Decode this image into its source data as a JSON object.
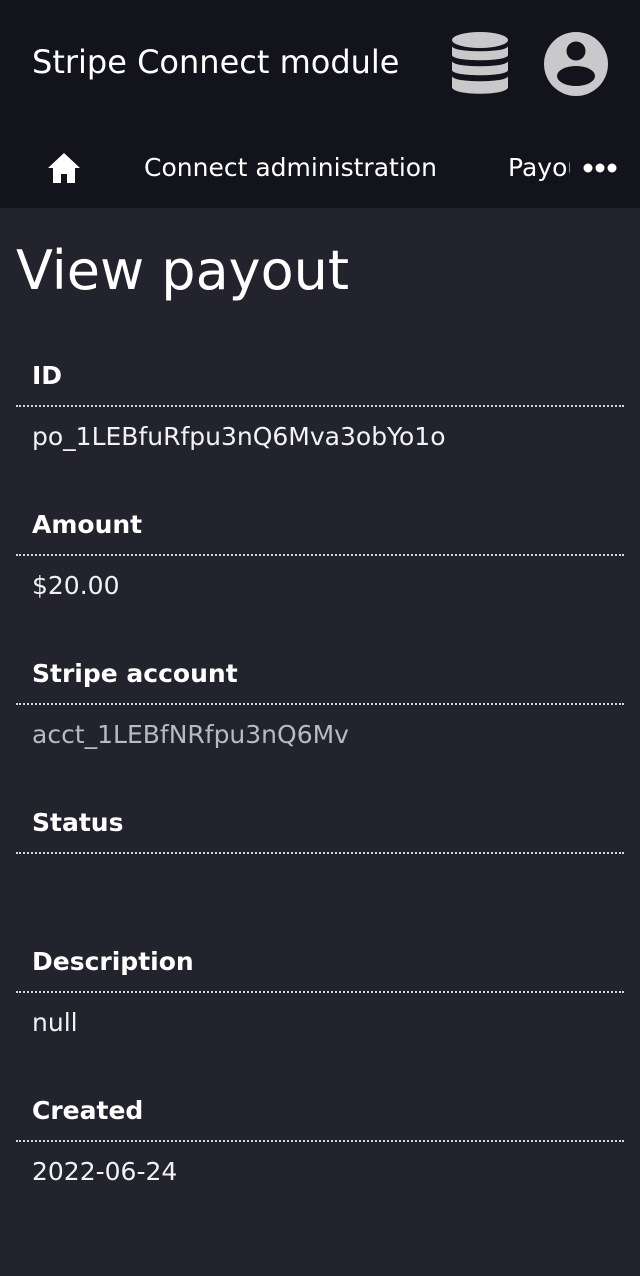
{
  "app": {
    "title": "Stripe Connect module"
  },
  "header": {
    "database_icon": "database-icon",
    "user_icon": "user-account-icon"
  },
  "nav": {
    "home_icon": "home-icon",
    "items": [
      {
        "label": "Connect administration"
      },
      {
        "label": "Payouts"
      }
    ],
    "more_icon": "more-horizontal-icon"
  },
  "page": {
    "title": "View payout"
  },
  "fields": [
    {
      "label": "ID",
      "value": "po_1LEBfuRfpu3nQ6Mva3obYo1o"
    },
    {
      "label": "Amount",
      "value": "$20.00"
    },
    {
      "label": "Stripe account",
      "value": "acct_1LEBfNRfpu3nQ6Mv"
    },
    {
      "label": "Status",
      "value": ""
    },
    {
      "label": "Description",
      "value": "null"
    },
    {
      "label": "Created",
      "value": "2022-06-24"
    }
  ],
  "colors": {
    "header_bg": "#13131c",
    "page_bg": "#22232d",
    "icon_gray": "#c9c9cc",
    "link_muted": "#b7bac6"
  }
}
